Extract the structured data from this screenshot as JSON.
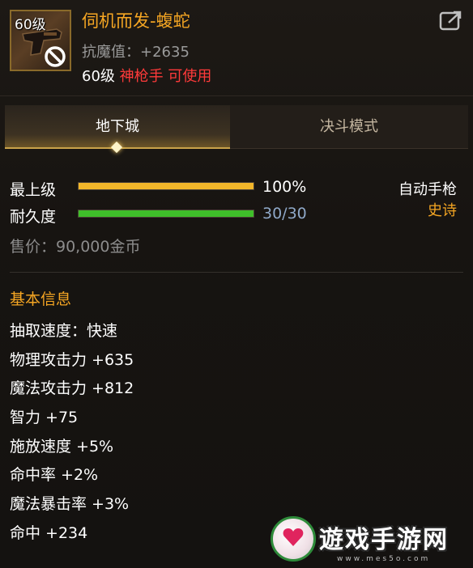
{
  "item": {
    "level_badge": "60级",
    "name": "伺机而发-蝮蛇",
    "stat_line": "抗魔值：+2635",
    "req_level": "60级",
    "req_class": "神枪手 可使用"
  },
  "tabs": [
    {
      "label": "地下城",
      "active": true
    },
    {
      "label": "决斗模式",
      "active": false
    }
  ],
  "bars": [
    {
      "label": "最上级",
      "value_text": "100%",
      "fill": 1.0,
      "color": "#f2b62a",
      "value_color": "#ffffff"
    },
    {
      "label": "耐久度",
      "value_text": "30/30",
      "fill": 1.0,
      "color": "#3fbf2a",
      "value_color": "#8fa8c8"
    }
  ],
  "weapon_type": "自动手枪",
  "rarity": "史诗",
  "price": "售价：90,000金币",
  "basic_info": {
    "title": "基本信息",
    "attributes": [
      "抽取速度：快速",
      "物理攻击力 +635",
      "魔法攻击力 +812",
      "智力 +75",
      "施放速度 +5%",
      "命中率 +2%",
      "魔法暴击率 +3%",
      "命中 +234"
    ]
  },
  "watermark": {
    "text": "遊戏手游网",
    "url": "www.mes5o.com"
  },
  "colors": {
    "accent_gold": "#f5a623",
    "class_red": "#ff3a3a",
    "tab_border": "#c9a24a"
  },
  "icons": [
    "pistol-icon",
    "forbidden-icon",
    "share-icon",
    "tab-diamond-icon",
    "heart-logo-icon"
  ]
}
